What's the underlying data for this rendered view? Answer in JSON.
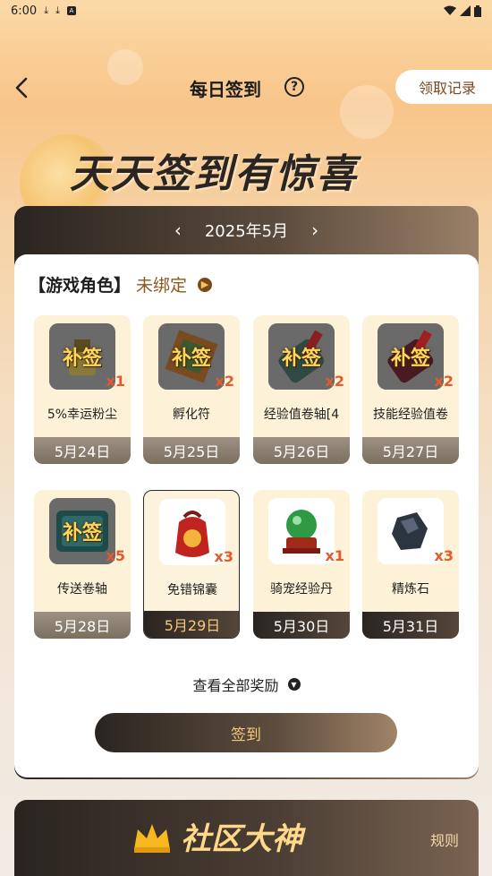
{
  "status_bar": {
    "time": "6:00",
    "icons_left": [
      "download-icon",
      "download-icon",
      "app-icon"
    ],
    "icons_right": [
      "wifi-icon",
      "signal-icon",
      "battery-icon"
    ]
  },
  "header": {
    "title": "每日签到",
    "record_label": "领取记录"
  },
  "banner": {
    "text": "天天签到有惊喜"
  },
  "calendar": {
    "month_label": "2025年5月"
  },
  "role": {
    "label": "【游戏角色】",
    "status": "未绑定"
  },
  "days": [
    {
      "name": "5%幸运粉尘",
      "qty": "x1",
      "date": "5月24日",
      "badge": "补签",
      "state": "past"
    },
    {
      "name": "孵化符",
      "qty": "x2",
      "date": "5月25日",
      "badge": "补签",
      "state": "past"
    },
    {
      "name": "经验值卷轴[4",
      "qty": "x2",
      "date": "5月26日",
      "badge": "补签",
      "state": "past"
    },
    {
      "name": "技能经验值卷",
      "qty": "x2",
      "date": "5月27日",
      "badge": "补签",
      "state": "past"
    },
    {
      "name": "传送卷轴",
      "qty": "x5",
      "date": "5月28日",
      "badge": "补签",
      "state": "past"
    },
    {
      "name": "免错锦囊",
      "qty": "x3",
      "date": "5月29日",
      "badge": "",
      "state": "today"
    },
    {
      "name": "骑宠经验丹",
      "qty": "x1",
      "date": "5月30日",
      "badge": "",
      "state": "future"
    },
    {
      "name": "精炼石",
      "qty": "x3",
      "date": "5月31日",
      "badge": "",
      "state": "future"
    }
  ],
  "view_all_label": "查看全部奖励",
  "signin_label": "签到",
  "community": {
    "title": "社区大神",
    "rules_label": "规则"
  },
  "colors": {
    "accent_gold": "#f5c878",
    "dark": "#2a2420",
    "qty_red": "#e25a2e",
    "role_status": "#8a5a1e"
  }
}
